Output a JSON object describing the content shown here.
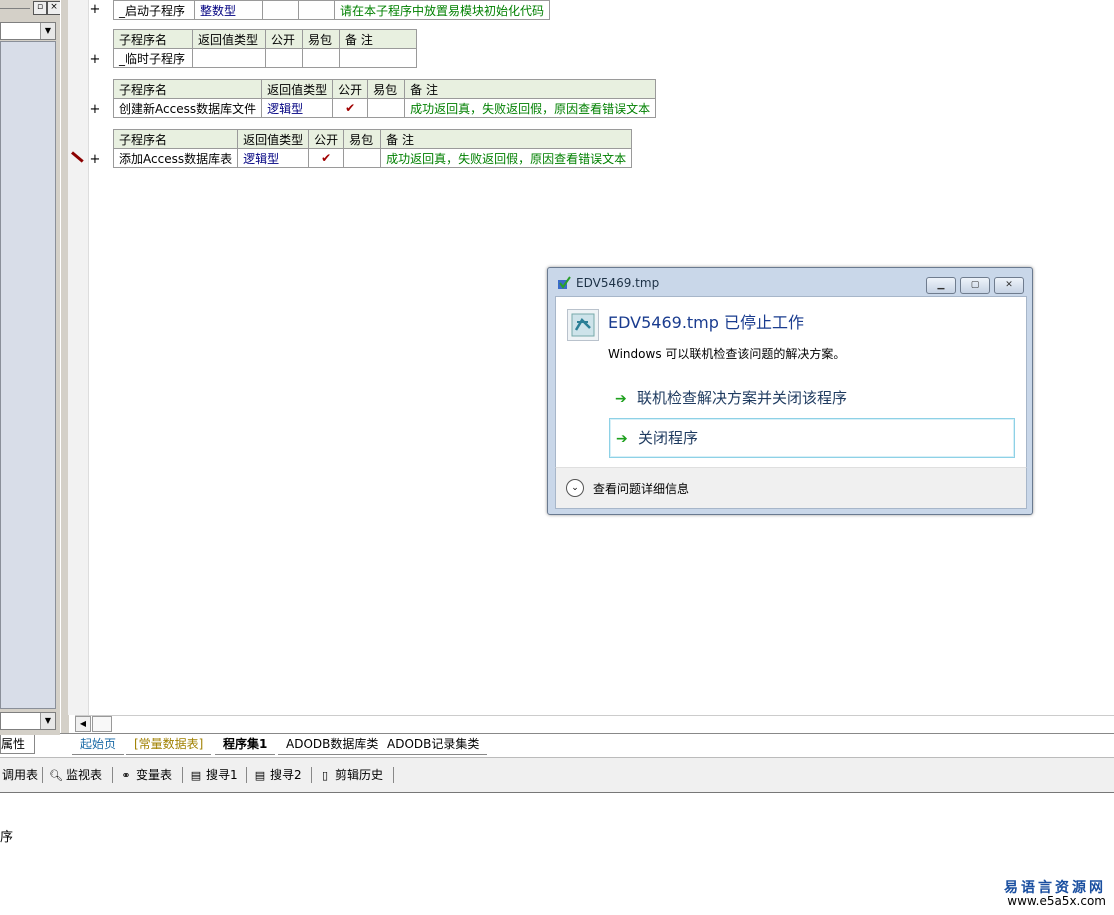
{
  "left_panel": {
    "properties_tab": "属性"
  },
  "subroutines": [
    {
      "name": "_启动子程序",
      "return_type": "整数型",
      "public": "",
      "package": "",
      "note": "请在本子程序中放置易模块初始化代码"
    },
    {
      "header": [
        "子程序名",
        "返回值类型",
        "公开",
        "易包",
        "备 注"
      ],
      "name": "_临时子程序",
      "return_type": "",
      "public": "",
      "package": "",
      "note": ""
    },
    {
      "header": [
        "子程序名",
        "返回值类型",
        "公开",
        "易包",
        "备 注"
      ],
      "name": "创建新Access数据库文件",
      "return_type": "逻辑型",
      "public": "✔",
      "package": "",
      "note": "成功返回真，失败返回假，原因查看错误文本"
    },
    {
      "header": [
        "子程序名",
        "返回值类型",
        "公开",
        "易包",
        "备 注"
      ],
      "name": "添加Access数据库表",
      "return_type": "逻辑型",
      "public": "✔",
      "package": "",
      "note": "成功返回真，失败返回假，原因查看错误文本"
    }
  ],
  "file_tabs": [
    "起始页",
    "[常量数据表]",
    "程序集1",
    "ADODB数据库类",
    "ADODB记录集类"
  ],
  "toolbar": [
    {
      "label": "调用表",
      "icon": "call-table-icon"
    },
    {
      "label": "监视表",
      "icon": "magnifier-icon"
    },
    {
      "label": "变量表",
      "icon": "variables-icon"
    },
    {
      "label": "搜寻1",
      "icon": "search1-icon"
    },
    {
      "label": "搜寻2",
      "icon": "search2-icon"
    },
    {
      "label": "剪辑历史",
      "icon": "clipboard-history-icon"
    }
  ],
  "output": {
    "text": "序"
  },
  "dialog": {
    "title": "EDV5469.tmp",
    "heading": "EDV5469.tmp 已停止工作",
    "description": "Windows 可以联机检查该问题的解决方案。",
    "option_check": "联机检查解决方案并关闭该程序",
    "option_close": "关闭程序",
    "details": "查看问题详细信息"
  },
  "watermark": {
    "title": "易语言资源网",
    "url": "www.e5a5x.com"
  },
  "colors": {
    "dialog_frame": "#c9d7e9",
    "heading_blue": "#1a3c8f",
    "note_green": "#008000",
    "type_blue": "#000080"
  }
}
